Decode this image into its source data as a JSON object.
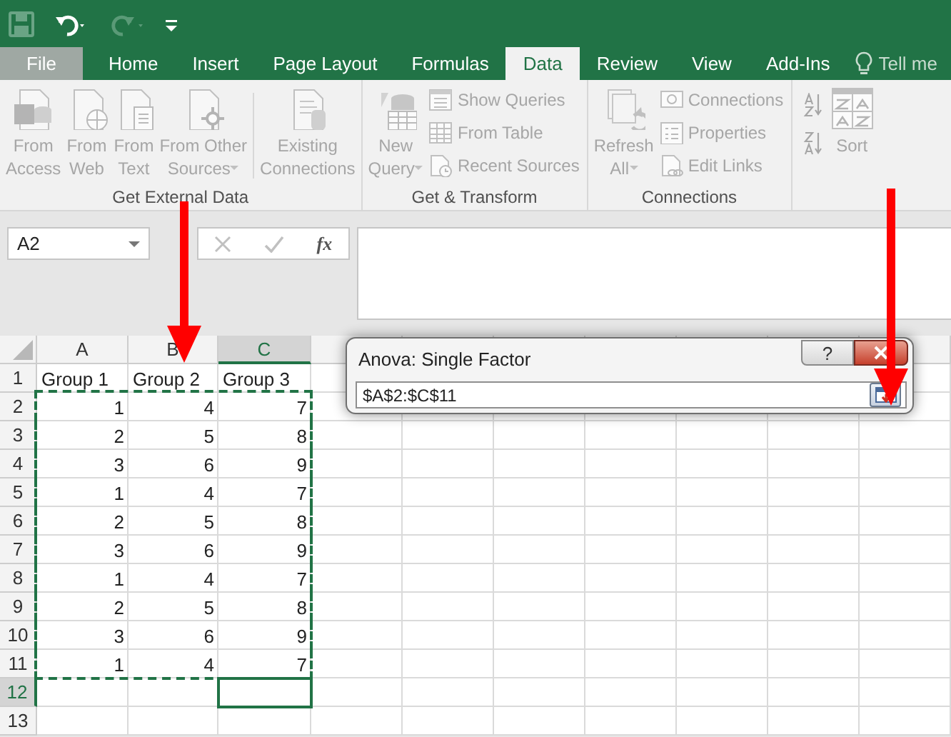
{
  "tabs": [
    {
      "label": "File",
      "kind": "file",
      "selected": false
    },
    {
      "label": "Home",
      "kind": "tab",
      "selected": false
    },
    {
      "label": "Insert",
      "kind": "tab",
      "selected": false
    },
    {
      "label": "Page Layout",
      "kind": "tab",
      "selected": false
    },
    {
      "label": "Formulas",
      "kind": "tab",
      "selected": false
    },
    {
      "label": "Data",
      "kind": "tab",
      "selected": true
    },
    {
      "label": "Review",
      "kind": "tab",
      "selected": false
    },
    {
      "label": "View",
      "kind": "tab",
      "selected": false
    },
    {
      "label": "Add-Ins",
      "kind": "tab",
      "selected": false
    }
  ],
  "tell_me": {
    "placeholder": "Tell me"
  },
  "ribbon_groups": [
    {
      "label": "Get External Data",
      "items": [
        {
          "kind": "large",
          "label": "From Access",
          "disabled": true,
          "dropdown": false
        },
        {
          "kind": "large",
          "label": "From Web",
          "disabled": true,
          "dropdown": false
        },
        {
          "kind": "large",
          "label": "From Text",
          "disabled": true,
          "dropdown": false
        },
        {
          "kind": "large",
          "label": "From Other Sources",
          "disabled": true,
          "dropdown": true
        },
        {
          "kind": "separator"
        },
        {
          "kind": "large",
          "label": "Existing Connections",
          "disabled": true,
          "dropdown": false
        }
      ]
    },
    {
      "label": "Get & Transform",
      "items": [
        {
          "kind": "large",
          "label": "New Query",
          "disabled": true,
          "dropdown": true
        },
        {
          "kind": "small",
          "label": "Show Queries",
          "disabled": true
        },
        {
          "kind": "small",
          "label": "From Table",
          "disabled": true
        },
        {
          "kind": "small",
          "label": "Recent Sources",
          "disabled": true
        }
      ]
    },
    {
      "label": "Connections",
      "items": [
        {
          "kind": "large",
          "label": "Refresh All",
          "disabled": true,
          "dropdown": true
        },
        {
          "kind": "small",
          "label": "Connections",
          "disabled": true
        },
        {
          "kind": "small",
          "label": "Properties",
          "disabled": true
        },
        {
          "kind": "small",
          "label": "Edit Links",
          "disabled": true
        }
      ]
    },
    {
      "items": [
        {
          "kind": "sort-icons",
          "disabled": true
        },
        {
          "kind": "large",
          "label": "Sort",
          "disabled": true
        }
      ]
    }
  ],
  "name_box": {
    "value": "A2"
  },
  "formula_bar": {
    "function_label": "fx"
  },
  "sheet": {
    "columns": [
      {
        "label": "A",
        "selected": false
      },
      {
        "label": "B",
        "selected": false
      },
      {
        "label": "C",
        "selected": true
      }
    ],
    "rows": [
      {
        "label": "1",
        "kind": "text",
        "selected": false,
        "in_range": false,
        "cells": [
          "Group 1",
          "Group 2",
          "Group 3"
        ]
      },
      {
        "label": "2",
        "kind": "number",
        "selected": false,
        "in_range": true,
        "cells": [
          "1",
          "4",
          "7"
        ]
      },
      {
        "label": "3",
        "kind": "number",
        "selected": false,
        "in_range": true,
        "cells": [
          "2",
          "5",
          "8"
        ]
      },
      {
        "label": "4",
        "kind": "number",
        "selected": false,
        "in_range": true,
        "cells": [
          "3",
          "6",
          "9"
        ]
      },
      {
        "label": "5",
        "kind": "number",
        "selected": false,
        "in_range": true,
        "cells": [
          "1",
          "4",
          "7"
        ]
      },
      {
        "label": "6",
        "kind": "number",
        "selected": false,
        "in_range": true,
        "cells": [
          "2",
          "5",
          "8"
        ]
      },
      {
        "label": "7",
        "kind": "number",
        "selected": false,
        "in_range": true,
        "cells": [
          "3",
          "6",
          "9"
        ]
      },
      {
        "label": "8",
        "kind": "number",
        "selected": false,
        "in_range": true,
        "cells": [
          "1",
          "4",
          "7"
        ]
      },
      {
        "label": "9",
        "kind": "number",
        "selected": false,
        "in_range": true,
        "cells": [
          "2",
          "5",
          "8"
        ]
      },
      {
        "label": "10",
        "kind": "number",
        "selected": false,
        "in_range": true,
        "cells": [
          "3",
          "6",
          "9"
        ]
      },
      {
        "label": "11",
        "kind": "number",
        "selected": false,
        "in_range": true,
        "cells": [
          "1",
          "4",
          "7"
        ]
      },
      {
        "label": "12",
        "selected": true,
        "in_range": false,
        "cells": []
      },
      {
        "label": "13",
        "selected": false,
        "in_range": false,
        "cells": []
      }
    ]
  },
  "dialog": {
    "title": "Anova: Single Factor",
    "help": "?",
    "input": {
      "value": "$A$2:$C$11"
    }
  }
}
